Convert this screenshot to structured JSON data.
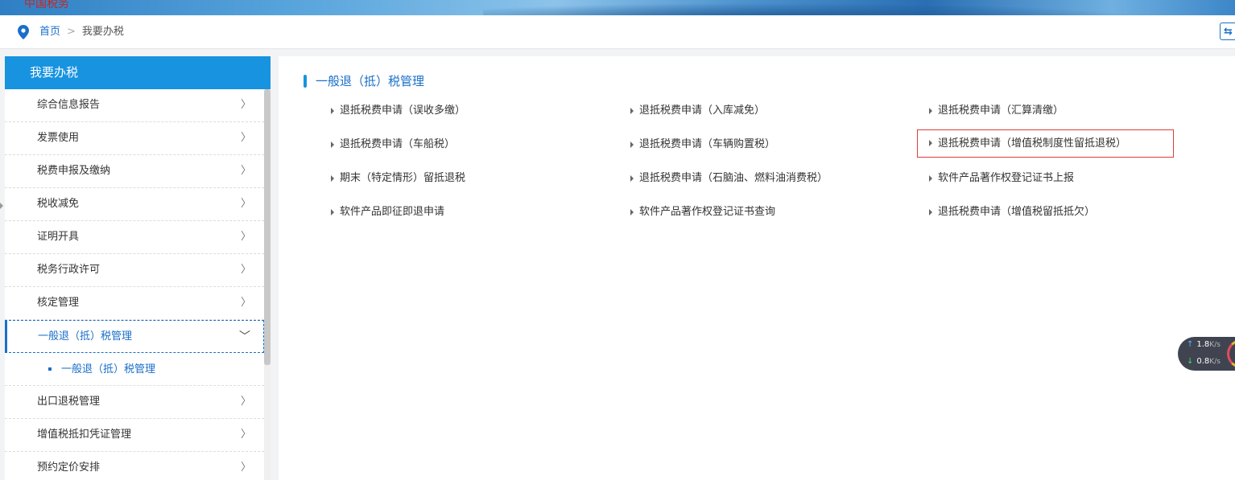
{
  "banner": {
    "logo_text": "中国税务"
  },
  "breadcrumb": {
    "home": "首页",
    "separator": ">",
    "current": "我要办税"
  },
  "sidebar": {
    "title": "我要办税",
    "items": [
      {
        "label": "综合信息报告",
        "chevron": "〉"
      },
      {
        "label": "发票使用",
        "chevron": "〉"
      },
      {
        "label": "税费申报及缴纳",
        "chevron": "〉"
      },
      {
        "label": "税收减免",
        "chevron": "〉"
      },
      {
        "label": "证明开具",
        "chevron": "〉"
      },
      {
        "label": "税务行政许可",
        "chevron": "〉"
      },
      {
        "label": "核定管理",
        "chevron": "〉"
      },
      {
        "label": "一般退（抵）税管理",
        "chevron": "﹀"
      },
      {
        "label": "出口退税管理",
        "chevron": "〉"
      },
      {
        "label": "增值税抵扣凭证管理",
        "chevron": "〉"
      },
      {
        "label": "预约定价安排",
        "chevron": "〉"
      }
    ],
    "sub_items": [
      {
        "label": "一般退（抵）税管理"
      }
    ]
  },
  "main": {
    "section_title": "一般退（抵）税管理",
    "links": [
      {
        "label": "退抵税费申请（误收多缴）"
      },
      {
        "label": "退抵税费申请（入库减免）"
      },
      {
        "label": "退抵税费申请（汇算清缴）"
      },
      {
        "label": "退抵税费申请（车船税）"
      },
      {
        "label": "退抵税费申请（车辆购置税）"
      },
      {
        "label": "退抵税费申请（增值税制度性留抵退税）"
      },
      {
        "label": "期末（特定情形）留抵退税"
      },
      {
        "label": "退抵税费申请（石脑油、燃料油消费税）"
      },
      {
        "label": "软件产品著作权登记证书上报"
      },
      {
        "label": "软件产品即征即退申请"
      },
      {
        "label": "软件产品著作权登记证书查询"
      },
      {
        "label": "退抵税费申请（增值税留抵抵欠）"
      }
    ]
  },
  "net_widget": {
    "up": "1.8",
    "down": "0.8",
    "unit": "K/s"
  },
  "colors": {
    "accent": "#1793e0",
    "link": "#1a6fc9",
    "highlight": "#e03b3b"
  }
}
